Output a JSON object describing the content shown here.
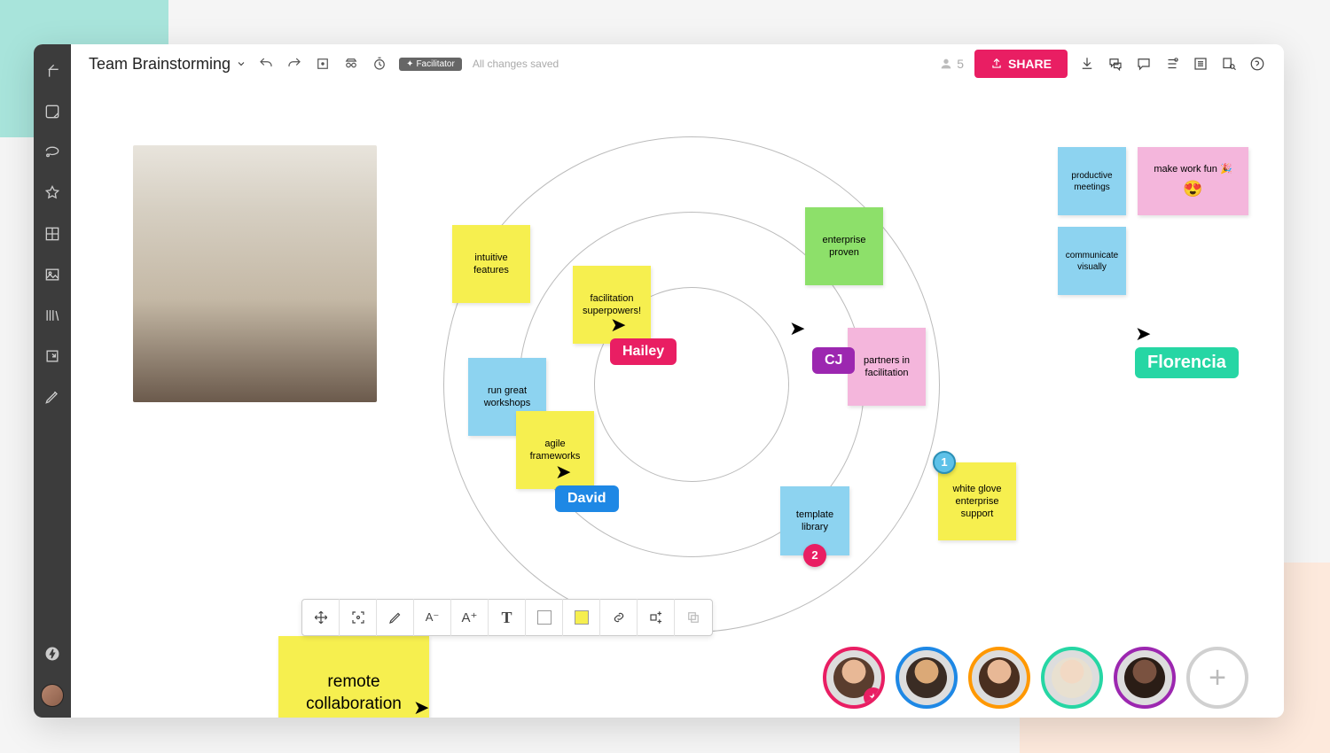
{
  "board": {
    "title": "Team Brainstorming",
    "facilitator_badge": "Facilitator",
    "saved_text": "All changes saved",
    "participant_count": "5",
    "share_label": "SHARE"
  },
  "stickies": {
    "intuitive": "intuitive features",
    "facilitation": "facilitation superpowers!",
    "workshops": "run great workshops",
    "agile": "agile frameworks",
    "enterprise": "enterprise proven",
    "partners": "partners in facilitation",
    "template": "template library",
    "whiteglove": "white glove enterprise support",
    "remote": "remote collaboration",
    "productive": "productive meetings",
    "makework": "make work fun 🎉",
    "communicate": "communicate visually"
  },
  "cursors": {
    "hailey": "Hailey",
    "cj": "CJ",
    "david": "David",
    "florencia": "Florencia"
  },
  "badges": {
    "one": "1",
    "two": "2"
  },
  "emoji": {
    "hearteyes": "😍"
  },
  "colors": {
    "hailey": "#e91e63",
    "cj": "#9c27b0",
    "david": "#1e88e5",
    "florencia": "#26d6a4"
  },
  "avatars": [
    {
      "ring": "#e91e63"
    },
    {
      "ring": "#1e88e5"
    },
    {
      "ring": "#ff9800"
    },
    {
      "ring": "#26d6a4"
    },
    {
      "ring": "#9c27b0"
    }
  ]
}
